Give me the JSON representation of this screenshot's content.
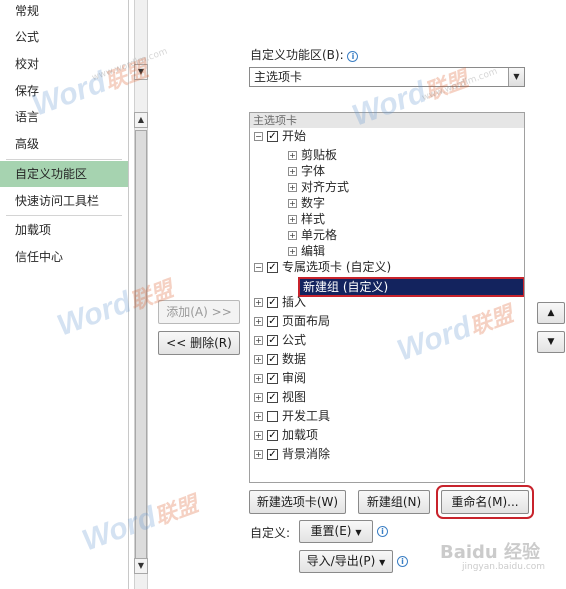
{
  "nav": {
    "items": [
      "常规",
      "公式",
      "校对",
      "保存",
      "语言",
      "高级",
      "自定义功能区",
      "快速访问工具栏",
      "加载项",
      "信任中心"
    ],
    "selected_index": 6
  },
  "customize": {
    "label": "自定义功能区(B):",
    "dropdown_value": "主选项卡"
  },
  "tree": {
    "header": "主选项卡",
    "start_tab": "开始",
    "start_groups": [
      "剪贴板",
      "字体",
      "对齐方式",
      "数字",
      "样式",
      "单元格",
      "编辑"
    ],
    "custom_tab": "专属选项卡 (自定义)",
    "new_group": "新建组 (自定义)",
    "other_tabs": [
      {
        "label": "插入",
        "checked": true
      },
      {
        "label": "页面布局",
        "checked": true
      },
      {
        "label": "公式",
        "checked": true
      },
      {
        "label": "数据",
        "checked": true
      },
      {
        "label": "审阅",
        "checked": true
      },
      {
        "label": "视图",
        "checked": true
      },
      {
        "label": "开发工具",
        "checked": false
      },
      {
        "label": "加载项",
        "checked": true
      },
      {
        "label": "背景消除",
        "checked": true
      }
    ]
  },
  "buttons": {
    "add": "添加(A) >>",
    "remove": "<< 删除(R)",
    "new_tab": "新建选项卡(W)",
    "new_group": "新建组(N)",
    "rename": "重命名(M)...",
    "customize_label": "自定义:",
    "reset": "重置(E)",
    "import_export": "导入/导出(P)"
  },
  "watermarks": {
    "brand_en": "Word",
    "brand_cn": "联盟",
    "site": "www.wordlm.com",
    "baidu": "Baidu 经验",
    "baidu_site": "jingyan.baidu.com"
  },
  "colors": {
    "nav_selected": "#a6d3b0",
    "tree_selected": "#13235e",
    "highlight_border": "#c8232c"
  }
}
